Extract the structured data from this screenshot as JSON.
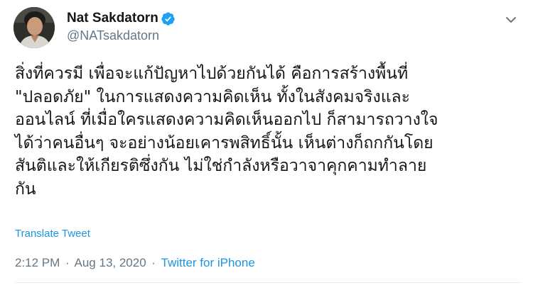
{
  "user": {
    "display_name": "Nat Sakdatorn",
    "handle": "@NATsakdatorn",
    "verified": true,
    "avatar_icon": "profile-photo"
  },
  "tweet": {
    "lines": [
      "สิ่งที่ควรมี เพื่อจะแก้ปัญหาไปด้วยกันได้ คือการสร้างพื้นที่",
      "\"ปลอดภัย\" ในการแสดงความคิดเห็น ทั้งในสังคมจริงและ",
      "ออนไลน์ ที่เมื่อใครแสดงความคิดเห็นออกไป ก็สามารถวางใจ",
      "ได้ว่าคนอื่นๆ จะอย่างน้อยเคารพสิทธิ์นั้น เห็นต่างก็ถกกันโดย",
      "สันติและให้เกียรติซึ่งกัน ไม่ใช่กำลังหรือวาจาคุกคามทำลาย",
      "กัน"
    ],
    "translate_label": "Translate Tweet",
    "time": "2:12 PM",
    "separator": "·",
    "date": "Aug 13, 2020",
    "source": "Twitter for iPhone"
  },
  "colors": {
    "link": "#1b95e0",
    "secondary_text": "#657786",
    "primary_text": "#14171a",
    "verified_badge": "#1da1f2"
  },
  "icons": {
    "verified": "verified-badge-icon",
    "more": "chevron-down-icon"
  }
}
